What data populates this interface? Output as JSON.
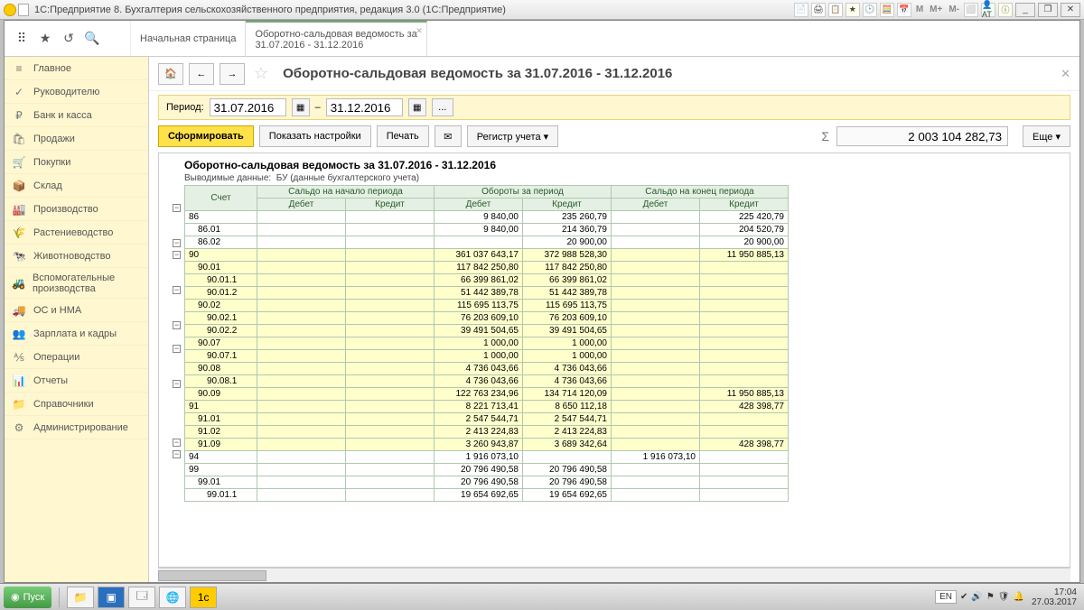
{
  "window_title": "1С:Предприятие 8. Бухгалтерия сельскохозяйственного предприятия, редакция 3.0  (1С:Предприятие)",
  "tabs": {
    "start": "Начальная страница",
    "report_l1": "Оборотно-сальдовая ведомость за",
    "report_l2": "31.07.2016 - 31.12.2016"
  },
  "sidebar": [
    {
      "icon": "≡",
      "label": "Главное"
    },
    {
      "icon": "✓",
      "label": "Руководителю"
    },
    {
      "icon": "₽",
      "label": "Банк и касса"
    },
    {
      "icon": "🛍",
      "label": "Продажи"
    },
    {
      "icon": "🛒",
      "label": "Покупки"
    },
    {
      "icon": "📦",
      "label": "Склад"
    },
    {
      "icon": "🏭",
      "label": "Производство"
    },
    {
      "icon": "🌾",
      "label": "Растениеводство"
    },
    {
      "icon": "🐄",
      "label": "Животноводство"
    },
    {
      "icon": "🚜",
      "label": "Вспомогательные производства"
    },
    {
      "icon": "🚚",
      "label": "ОС и НМА"
    },
    {
      "icon": "👥",
      "label": "Зарплата и кадры"
    },
    {
      "icon": "⅍",
      "label": "Операции"
    },
    {
      "icon": "📊",
      "label": "Отчеты"
    },
    {
      "icon": "📁",
      "label": "Справочники"
    },
    {
      "icon": "⚙",
      "label": "Администрирование"
    }
  ],
  "page_title": "Оборотно-сальдовая ведомость за 31.07.2016 - 31.12.2016",
  "period_label": "Период:",
  "date_from": "31.07.2016",
  "date_to": "31.12.2016",
  "dash": "–",
  "buttons": {
    "form": "Сформировать",
    "settings": "Показать настройки",
    "print": "Печать",
    "register": "Регистр учета",
    "more": "Еще"
  },
  "sum_value": "2 003 104 282,73",
  "report_title": "Оборотно-сальдовая ведомость за 31.07.2016 - 31.12.2016",
  "report_sub_l": "Выводимые данные:",
  "report_sub_v": "БУ (данные бухгалтерского учета)",
  "cols": {
    "acct": "Счет",
    "sald_beg": "Сальдо на начало периода",
    "turn": "Обороты за период",
    "sald_end": "Сальдо на конец периода",
    "debit": "Дебет",
    "credit": "Кредит"
  },
  "rows": [
    {
      "a": "86",
      "d1": "",
      "c1": "",
      "d2": "9 840,00",
      "c2": "235 260,79",
      "d3": "",
      "c3": "225 420,79",
      "hl": 0
    },
    {
      "a": "86.01",
      "d1": "",
      "c1": "",
      "d2": "9 840,00",
      "c2": "214 360,79",
      "d3": "",
      "c3": "204 520,79",
      "hl": 0
    },
    {
      "a": "86.02",
      "d1": "",
      "c1": "",
      "d2": "",
      "c2": "20 900,00",
      "d3": "",
      "c3": "20 900,00",
      "hl": 0
    },
    {
      "a": "90",
      "d1": "",
      "c1": "",
      "d2": "361 037 643,17",
      "c2": "372 988 528,30",
      "d3": "",
      "c3": "11 950 885,13",
      "hl": 1
    },
    {
      "a": "90.01",
      "d1": "",
      "c1": "",
      "d2": "117 842 250,80",
      "c2": "117 842 250,80",
      "d3": "",
      "c3": "",
      "hl": 1
    },
    {
      "a": "90.01.1",
      "d1": "",
      "c1": "",
      "d2": "66 399 861,02",
      "c2": "66 399 861,02",
      "d3": "",
      "c3": "",
      "hl": 1
    },
    {
      "a": "90.01.2",
      "d1": "",
      "c1": "",
      "d2": "51 442 389,78",
      "c2": "51 442 389,78",
      "d3": "",
      "c3": "",
      "hl": 1
    },
    {
      "a": "90.02",
      "d1": "",
      "c1": "",
      "d2": "115 695 113,75",
      "c2": "115 695 113,75",
      "d3": "",
      "c3": "",
      "hl": 1
    },
    {
      "a": "90.02.1",
      "d1": "",
      "c1": "",
      "d2": "76 203 609,10",
      "c2": "76 203 609,10",
      "d3": "",
      "c3": "",
      "hl": 1
    },
    {
      "a": "90.02.2",
      "d1": "",
      "c1": "",
      "d2": "39 491 504,65",
      "c2": "39 491 504,65",
      "d3": "",
      "c3": "",
      "hl": 1
    },
    {
      "a": "90.07",
      "d1": "",
      "c1": "",
      "d2": "1 000,00",
      "c2": "1 000,00",
      "d3": "",
      "c3": "",
      "hl": 1
    },
    {
      "a": "90.07.1",
      "d1": "",
      "c1": "",
      "d2": "1 000,00",
      "c2": "1 000,00",
      "d3": "",
      "c3": "",
      "hl": 1
    },
    {
      "a": "90.08",
      "d1": "",
      "c1": "",
      "d2": "4 736 043,66",
      "c2": "4 736 043,66",
      "d3": "",
      "c3": "",
      "hl": 1
    },
    {
      "a": "90.08.1",
      "d1": "",
      "c1": "",
      "d2": "4 736 043,66",
      "c2": "4 736 043,66",
      "d3": "",
      "c3": "",
      "hl": 1
    },
    {
      "a": "90.09",
      "d1": "",
      "c1": "",
      "d2": "122 763 234,96",
      "c2": "134 714 120,09",
      "d3": "",
      "c3": "11 950 885,13",
      "hl": 1
    },
    {
      "a": "91",
      "d1": "",
      "c1": "",
      "d2": "8 221 713,41",
      "c2": "8 650 112,18",
      "d3": "",
      "c3": "428 398,77",
      "hl": 1
    },
    {
      "a": "91.01",
      "d1": "",
      "c1": "",
      "d2": "2 547 544,71",
      "c2": "2 547 544,71",
      "d3": "",
      "c3": "",
      "hl": 1
    },
    {
      "a": "91.02",
      "d1": "",
      "c1": "",
      "d2": "2 413 224,83",
      "c2": "2 413 224,83",
      "d3": "",
      "c3": "",
      "hl": 1
    },
    {
      "a": "91.09",
      "d1": "",
      "c1": "",
      "d2": "3 260 943,87",
      "c2": "3 689 342,64",
      "d3": "",
      "c3": "428 398,77",
      "hl": 1
    },
    {
      "a": "94",
      "d1": "",
      "c1": "",
      "d2": "1 916 073,10",
      "c2": "",
      "d3": "1 916 073,10",
      "c3": "",
      "hl": 0
    },
    {
      "a": "99",
      "d1": "",
      "c1": "",
      "d2": "20 796 490,58",
      "c2": "20 796 490,58",
      "d3": "",
      "c3": "",
      "hl": 0
    },
    {
      "a": "99.01",
      "d1": "",
      "c1": "",
      "d2": "20 796 490,58",
      "c2": "20 796 490,58",
      "d3": "",
      "c3": "",
      "hl": 0
    },
    {
      "a": "99.01.1",
      "d1": "",
      "c1": "",
      "d2": "19 654 692,65",
      "c2": "19 654 692,65",
      "d3": "",
      "c3": "",
      "hl": 0
    }
  ],
  "tree": [
    "⊟",
    "",
    "",
    "⊟",
    "⊟",
    "",
    "",
    "⊟",
    "",
    "",
    "⊟",
    "",
    "⊟",
    "",
    "",
    "⊟",
    "",
    "",
    "",
    "",
    "⊟",
    "⊟",
    ""
  ],
  "taskbar": {
    "start": "Пуск",
    "lang": "EN",
    "time": "17:04",
    "date": "27.03.2017"
  }
}
